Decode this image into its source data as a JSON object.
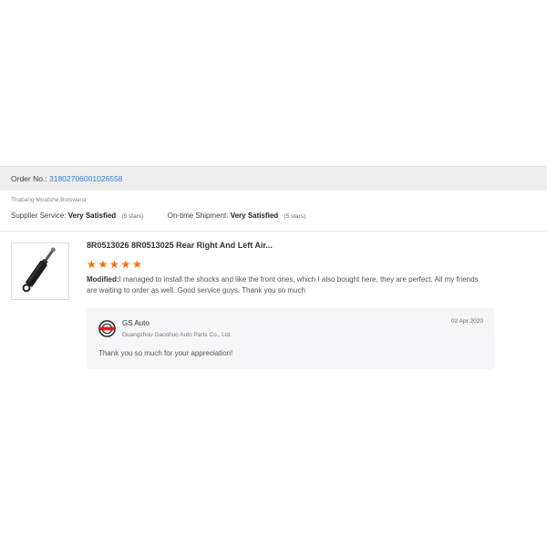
{
  "order": {
    "label": "Order No.:",
    "number": "31802706001026558"
  },
  "buyer": {
    "name_location": "Thabang Moatshe,Botswana"
  },
  "ratings": {
    "supplier_label": "Supplier Service:",
    "supplier_value": "Very Satisfied",
    "supplier_stars": "(5 stars)",
    "shipment_label": "On-time Shipment:",
    "shipment_value": "Very Satisfied",
    "shipment_stars": "(5 stars)"
  },
  "product": {
    "title": "8R0513026 8R0513025 Rear Right And Left Air...",
    "rating": 5,
    "star_glyph": "★",
    "star_color": "#ff6a00",
    "image_icon": "shock-absorber-image"
  },
  "review": {
    "label": "Modified:",
    "text": "I managed to install the shocks and like the front ones, which I also bought here, they are perfect. All my friends are waiting to order as well. Good service guys. Thank you so much"
  },
  "reply": {
    "seller": "GS Auto",
    "company": "Guangzhou Gaoshuo Auto Parts Co., Ltd.",
    "date": "02 Apr 2020",
    "text": "Thank you so much for your appreciation!",
    "logo_icon": "gs-auto-logo"
  },
  "colors": {
    "link": "#2e7fd6",
    "accent": "#ff6a00",
    "header_bg": "#eeeeee",
    "reply_bg": "#f6f6f8"
  }
}
